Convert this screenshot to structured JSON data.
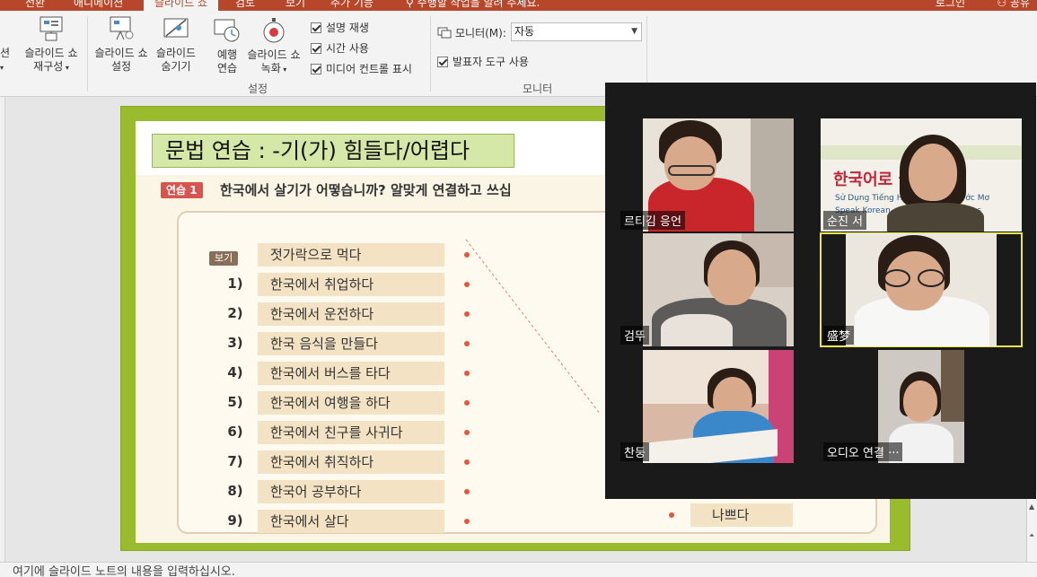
{
  "ribbon_tabs": {
    "transition": "전환",
    "animation": "애니메이션",
    "slideshow": "슬라이드 쇼",
    "review": "검토",
    "view": "보기",
    "addins": "추가 기능",
    "tell_me": "수행할 작업을 알려 주세요.",
    "login": "로그인",
    "share": "공유"
  },
  "ribbon": {
    "cutoff_left": "션",
    "custom_show_line1": "슬라이드 쇼",
    "custom_show_line2": "재구성",
    "setup_line1": "슬라이드 쇼",
    "setup_line2": "설정",
    "hide_line1": "슬라이드",
    "hide_line2": "숨기기",
    "rehearse_line1": "예행",
    "rehearse_line2": "연습",
    "record_line1": "슬라이드 쇼",
    "record_line2": "녹화",
    "play_narration": "설명 재생",
    "use_timings": "시간 사용",
    "media_controls": "미디어 컨트롤 표시",
    "setup_group": "설정",
    "monitor_label": "모니터(M):",
    "monitor_value": "자동",
    "presenter_view": "발표자 도구 사용",
    "monitor_group": "모니터"
  },
  "slide": {
    "title": "문법 연습",
    "title_suffix": ": -기(가) 힘들다/어렵다",
    "exercise_badge": "연습 1",
    "exercise_question": "한국에서 살기가 어떻습니까? 알맞게 연결하고 쓰십",
    "example_tag": "보기",
    "example_phrase": "젓가락으로 먹다",
    "items": [
      {
        "num": "1)",
        "text": "한국에서 취업하다"
      },
      {
        "num": "2)",
        "text": "한국에서 운전하다"
      },
      {
        "num": "3)",
        "text": "한국 음식을 만들다"
      },
      {
        "num": "4)",
        "text": "한국에서 버스를 타다"
      },
      {
        "num": "5)",
        "text": "한국에서 여행을 하다"
      },
      {
        "num": "6)",
        "text": "한국에서 친구를 사귀다"
      },
      {
        "num": "7)",
        "text": "한국에서 취직하다"
      },
      {
        "num": "8)",
        "text": "한국어 공부하다"
      },
      {
        "num": "9)",
        "text": "한국에서 살다"
      }
    ],
    "answer_visible": "나쁘다"
  },
  "notes_placeholder": "여기에 슬라이드 노트의 내용을 입력하십시오.",
  "participants": [
    {
      "name": "르티김 응언"
    },
    {
      "name": "순진 서"
    },
    {
      "name": "검뚜"
    },
    {
      "name": "盛梦"
    },
    {
      "name": "찬둥"
    },
    {
      "name": "오디오 연결 ···"
    }
  ],
  "colors": {
    "ribbon_accent": "#b7472a",
    "slide_border": "#9bbb2e",
    "active_speaker": "#e8e64a"
  }
}
